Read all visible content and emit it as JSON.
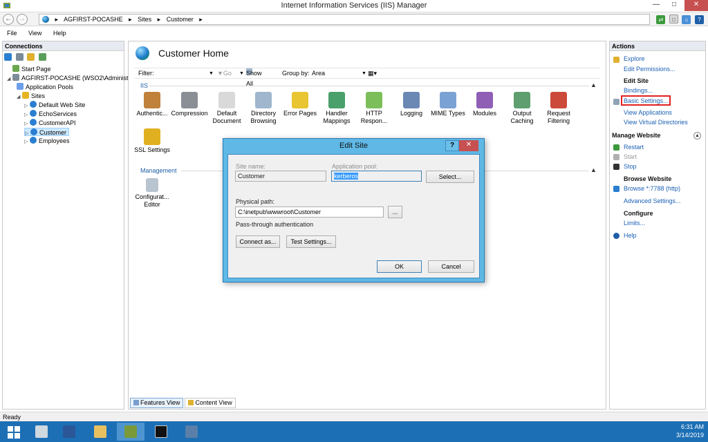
{
  "window": {
    "title": "Internet Information Services (IIS) Manager",
    "controls": {
      "minimize": "—",
      "maximize": "□",
      "close": "✕"
    }
  },
  "address": {
    "crumbs": [
      "AGFIRST-POCASHE",
      "▸",
      "Sites",
      "▸",
      "Customer",
      "▸"
    ]
  },
  "menu": {
    "items": [
      "File",
      "View",
      "Help"
    ]
  },
  "connections": {
    "header": "Connections",
    "tree": [
      {
        "label": "Start Page",
        "icon": "start-page-icon",
        "color": "#6aa84f"
      },
      {
        "label": "AGFIRST-POCASHE (WSO2\\Administrat",
        "icon": "server-icon",
        "color": "#7f8c99"
      },
      {
        "label": "Application Pools",
        "icon": "app-pools-icon",
        "color": "#6d9eeb"
      },
      {
        "label": "Sites",
        "icon": "folder-icon",
        "color": "#e6b422"
      },
      {
        "label": "Default Web Site",
        "icon": "globe-icon",
        "color": "#2a7fd1"
      },
      {
        "label": "EchoServices",
        "icon": "globe-icon",
        "color": "#2a7fd1"
      },
      {
        "label": "CustomerAPI",
        "icon": "globe-icon",
        "color": "#2a7fd1"
      },
      {
        "label": "Customer",
        "icon": "globe-icon",
        "color": "#2a7fd1"
      },
      {
        "label": "Employees",
        "icon": "globe-icon",
        "color": "#2a7fd1"
      }
    ]
  },
  "center": {
    "title": "Customer Home",
    "filter": {
      "label": "Filter:",
      "go": "Go",
      "show_all": "Show All",
      "group_by_label": "Group by:",
      "group_by_value": "Area"
    },
    "sections": {
      "iis": "IIS",
      "management": "Management"
    },
    "features": [
      {
        "line1": "Authentic...",
        "line2": "",
        "icon": "authentication-icon",
        "color": "#c0813a"
      },
      {
        "line1": "Compression",
        "line2": "",
        "icon": "compression-icon",
        "color": "#8a8f96"
      },
      {
        "line1": "Default",
        "line2": "Document",
        "icon": "default-document-icon",
        "color": "#d9d9d9"
      },
      {
        "line1": "Directory",
        "line2": "Browsing",
        "icon": "directory-browsing-icon",
        "color": "#9fb6cd"
      },
      {
        "line1": "Error Pages",
        "line2": "",
        "icon": "error-pages-icon",
        "color": "#e8c531"
      },
      {
        "line1": "Handler",
        "line2": "Mappings",
        "icon": "handler-mappings-icon",
        "color": "#4aa06a"
      },
      {
        "line1": "HTTP",
        "line2": "Respon...",
        "icon": "http-response-icon",
        "color": "#7cbf5a"
      },
      {
        "line1": "Logging",
        "line2": "",
        "icon": "logging-icon",
        "color": "#6b87b4"
      },
      {
        "line1": "MIME Types",
        "line2": "",
        "icon": "mime-types-icon",
        "color": "#7aa3d4"
      },
      {
        "line1": "Modules",
        "line2": "",
        "icon": "modules-icon",
        "color": "#8e5fb5"
      },
      {
        "line1": "Output",
        "line2": "Caching",
        "icon": "output-caching-icon",
        "color": "#5f9e6e"
      },
      {
        "line1": "Request",
        "line2": "Filtering",
        "icon": "request-filtering-icon",
        "color": "#cc4a3a"
      },
      {
        "line1": "SSL Settings",
        "line2": "",
        "icon": "ssl-settings-icon",
        "color": "#e0b020"
      }
    ],
    "management_features": [
      {
        "line1": "Configurat...",
        "line2": "Editor",
        "icon": "configuration-editor-icon",
        "color": "#b8c4d0"
      }
    ],
    "view_tabs": [
      "Features View",
      "Content View"
    ]
  },
  "actions": {
    "header": "Actions",
    "items": {
      "explore": "Explore",
      "edit_permissions": "Edit Permissions...",
      "edit_site": "Edit Site",
      "bindings": "Bindings...",
      "basic_settings": "Basic Settings...",
      "view_applications": "View Applications",
      "view_virtual_directories": "View Virtual Directories",
      "manage_website": "Manage Website",
      "restart": "Restart",
      "start": "Start",
      "stop": "Stop",
      "browse_website": "Browse Website",
      "browse_port": "Browse *:7788 (http)",
      "advanced_settings": "Advanced Settings...",
      "configure": "Configure",
      "limits": "Limits...",
      "help": "Help"
    }
  },
  "status": {
    "text": "Ready"
  },
  "taskbar": {
    "time": "6:31 AM",
    "date": "3/14/2019"
  },
  "dialog": {
    "title": "Edit Site",
    "help": "?",
    "close": "✕",
    "site_name_label": "Site name:",
    "site_name_value": "Customer",
    "app_pool_label": "Application pool:",
    "app_pool_value": "kerberos",
    "select_button": "Select...",
    "physical_path_label": "Physical path:",
    "physical_path_value": "C:\\inetpub\\wwwroot\\Customer",
    "browse_button": "...",
    "passthrough_label": "Pass-through authentication",
    "connect_as_button": "Connect as...",
    "test_settings_button": "Test Settings...",
    "ok_button": "OK",
    "cancel_button": "Cancel"
  }
}
